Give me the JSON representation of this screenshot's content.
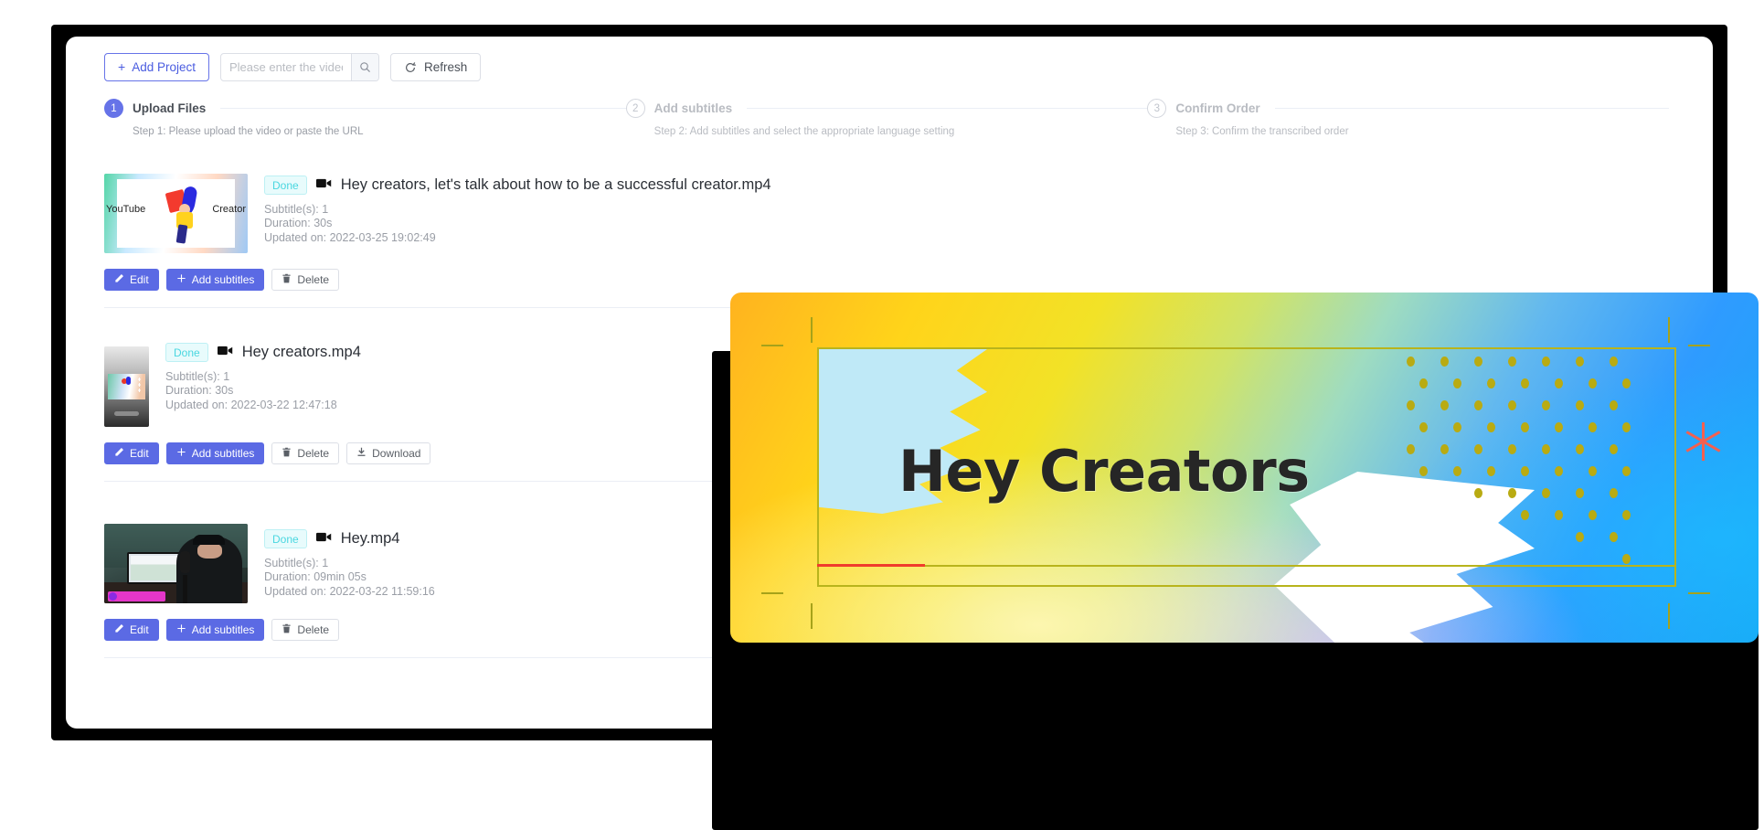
{
  "toolbar": {
    "add_project_label": "Add Project",
    "add_project_plus": "+",
    "search_placeholder": "Please enter the video name",
    "search_value": "",
    "search_icon": "search-icon",
    "refresh_label": "Refresh",
    "refresh_icon": "refresh-icon"
  },
  "steps": [
    {
      "number": "1",
      "title": "Upload Files",
      "description": "Step 1: Please upload the video or paste the URL",
      "state": "active"
    },
    {
      "number": "2",
      "title": "Add subtitles",
      "description": "Step 2: Add subtitles and select the appropriate language setting",
      "state": "idle"
    },
    {
      "number": "3",
      "title": "Confirm Order",
      "description": "Step 3: Confirm the transcribed order",
      "state": "idle"
    }
  ],
  "videos": [
    {
      "status_badge": "Done",
      "file_name": "Hey creators, let's talk about how to be a successful creator.mp4",
      "subtitles": "Subtitle(s): 1",
      "duration": "Duration: 30s",
      "updated": "Updated on: 2022-03-25 19:02:49",
      "thumb_kind": "wide",
      "thumb_art": "tn1",
      "thumb_labels": {
        "left": "YouTube",
        "right": "Creator"
      },
      "actions": [
        {
          "label": "Edit",
          "icon": "pencil-icon",
          "style": "primary"
        },
        {
          "label": "Add subtitles",
          "icon": "plus-icon",
          "style": "primary"
        },
        {
          "label": "Delete",
          "icon": "trash-icon",
          "style": "plain"
        }
      ]
    },
    {
      "status_badge": "Done",
      "file_name": "Hey creators.mp4",
      "subtitles": "Subtitle(s): 1",
      "duration": "Duration: 30s",
      "updated": "Updated on: 2022-03-22 12:47:18",
      "thumb_kind": "narrow",
      "thumb_art": "tn2",
      "thumb_labels": {
        "left": "",
        "right": ""
      },
      "actions": [
        {
          "label": "Edit",
          "icon": "pencil-icon",
          "style": "primary"
        },
        {
          "label": "Add subtitles",
          "icon": "plus-icon",
          "style": "primary"
        },
        {
          "label": "Delete",
          "icon": "trash-icon",
          "style": "plain"
        },
        {
          "label": "Download",
          "icon": "download-icon",
          "style": "plain"
        }
      ]
    },
    {
      "status_badge": "Done",
      "file_name": "Hey.mp4",
      "subtitles": "Subtitle(s): 1",
      "duration": "Duration: 09min 05s",
      "updated": "Updated on: 2022-03-22 11:59:16",
      "thumb_kind": "wide",
      "thumb_art": "tn3",
      "thumb_labels": {
        "left": "",
        "right": ""
      },
      "actions": [
        {
          "label": "Edit",
          "icon": "pencil-icon",
          "style": "primary"
        },
        {
          "label": "Add subtitles",
          "icon": "plus-icon",
          "style": "primary"
        },
        {
          "label": "Delete",
          "icon": "trash-icon",
          "style": "plain"
        }
      ]
    }
  ],
  "overlay": {
    "heading": "Hey Creators",
    "progress_color": "#f03b2c",
    "frame_color": "#b8b41c",
    "dot_color": "#b9ab12",
    "star_color": "#f4604f"
  },
  "colors": {
    "accent": "#5b6ae4",
    "accent_outline": "#6673e8",
    "badge_text": "#4ad7e0",
    "badge_bg": "#e8fbfc",
    "muted_text": "#9a9ea6",
    "border": "#dcdfe6"
  }
}
